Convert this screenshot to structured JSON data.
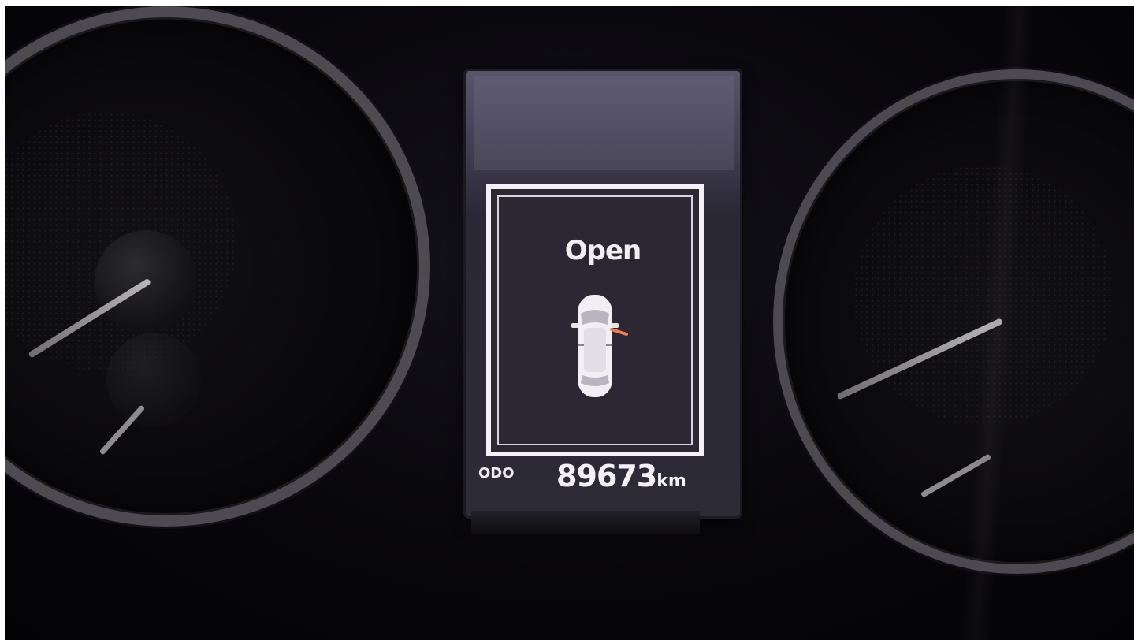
{
  "display": {
    "status": "Open",
    "odo_label": "ODO",
    "odometer_value": "89673",
    "odometer_unit": "km"
  },
  "icons": {
    "car": "car-top-view-icon",
    "door": "open-door-icon"
  },
  "colors": {
    "display_text": "#f4f1f6",
    "door_open_indicator": "#f07d4a",
    "background": "#07060a"
  }
}
